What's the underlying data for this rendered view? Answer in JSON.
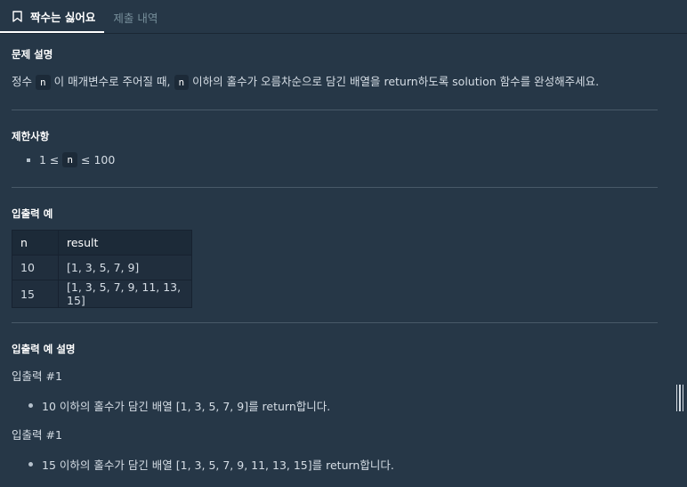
{
  "tabs": {
    "active": "짝수는 싫어요",
    "other": "제출 내역"
  },
  "section1": {
    "title": "문제 설명",
    "p_part1": "정수",
    "code_n": "n",
    "p_part2": "이 매개변수로 주어질 때,",
    "p_part3": "이하의 홀수가 오름차순으로 담긴 배열을 return하도록 solution 함수를 완성해주세요."
  },
  "section2": {
    "title": "제한사항",
    "c_pre": "1 ≤",
    "c_code": "n",
    "c_post": "≤ 100"
  },
  "section3": {
    "title": "입출력 예",
    "headers": [
      "n",
      "result"
    ],
    "rows": [
      [
        "10",
        "[1, 3, 5, 7, 9]"
      ],
      [
        "15",
        "[1, 3, 5, 7, 9, 11, 13, 15]"
      ]
    ]
  },
  "section4": {
    "title": "입출력 예 설명",
    "ex1_title": "입출력 #1",
    "ex1_text": "10 이하의 홀수가 담긴 배열 [1, 3, 5, 7, 9]를 return합니다.",
    "ex2_title": "입출력 #1",
    "ex2_text": "15 이하의 홀수가 담긴 배열 [1, 3, 5, 7, 9, 11, 13, 15]를 return합니다."
  }
}
